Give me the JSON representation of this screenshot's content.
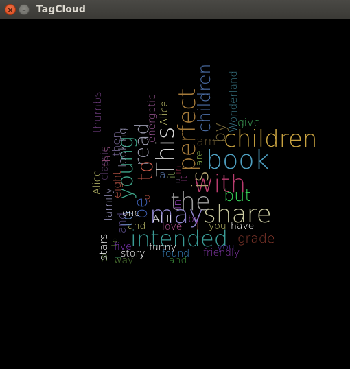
{
  "window": {
    "title": "TagCloud",
    "close_glyph": "×",
    "minimize_glyph": "–"
  },
  "cloud": {
    "words": [
      {
        "text": "share",
        "color": "#c9c9a0"
      },
      {
        "text": "may",
        "color": "#8b82c8"
      },
      {
        "text": "with",
        "color": "#b93c6e"
      },
      {
        "text": "children",
        "color": "#c8a240"
      },
      {
        "text": "book",
        "color": "#4e9fc0"
      },
      {
        "text": "the",
        "color": "#9c9c9c"
      },
      {
        "text": "intended",
        "color": "#3a9c96"
      },
      {
        "text": "is",
        "color": "#b0a070"
      },
      {
        "text": "This",
        "color": "#d8d8d8"
      },
      {
        "text": "perfect",
        "color": "#a57a3a"
      },
      {
        "text": "children",
        "color": "#4c6fa8"
      },
      {
        "text": "young",
        "color": "#3fa58a"
      },
      {
        "text": "read",
        "color": "#9c9cb0"
      },
      {
        "text": "to",
        "color": "#6a8fc8"
      },
      {
        "text": "to",
        "color": "#c85a4a"
      },
      {
        "text": "be",
        "color": "#3a5aa8"
      },
      {
        "text": "but",
        "color": "#39d65a"
      },
      {
        "text": "grade",
        "color": "#8a3a2e"
      },
      {
        "text": "by",
        "color": "#7a6a3a"
      },
      {
        "text": "Wonderland",
        "color": "#3a7a8a"
      },
      {
        "text": "give",
        "color": "#3fa55a"
      },
      {
        "text": "am",
        "color": "#5a4a2a"
      },
      {
        "text": "are",
        "color": "#8ab04a"
      },
      {
        "text": "energetic",
        "color": "#a05a9a"
      },
      {
        "text": "Alice",
        "color": "#c8c870"
      },
      {
        "text": "looking",
        "color": "#a09cc0"
      },
      {
        "text": "then",
        "color": "#7a6a9a"
      },
      {
        "text": "thumbs",
        "color": "#6a3a7a"
      },
      {
        "text": "this",
        "color": "#b05a8a"
      },
      {
        "text": "classic",
        "color": "#5a3a6a"
      },
      {
        "text": "a",
        "color": "#5a7ab0"
      },
      {
        "text": "eight",
        "color": "#c85a4a"
      },
      {
        "text": "family",
        "color": "#a09cc8"
      },
      {
        "text": "and",
        "color": "#6a5aa0"
      },
      {
        "text": "Alice",
        "color": "#c8c870"
      },
      {
        "text": "it",
        "color": "#a0c06a"
      },
      {
        "text": "in",
        "color": "#a02a4a"
      },
      {
        "text": "in",
        "color": "#5a4a6a"
      },
      {
        "text": "it",
        "color": "#9a3a8a"
      },
      {
        "text": "in",
        "color": "#a04ac8"
      },
      {
        "text": "A",
        "color": "#ffffff"
      },
      {
        "text": "to",
        "color": "#c85a4a"
      },
      {
        "text": "one",
        "color": "#ffffff"
      },
      {
        "text": "still",
        "color": "#ffffff"
      },
      {
        "text": "by",
        "color": "#8a3aa8"
      },
      {
        "text": "I",
        "color": "#c86a4a"
      },
      {
        "text": "and",
        "color": "#c8c870"
      },
      {
        "text": "love",
        "color": "#c85aa0"
      },
      {
        "text": "you",
        "color": "#c8c870"
      },
      {
        "text": "have",
        "color": "#ffffff"
      },
      {
        "text": "stars",
        "color": "#ffffff"
      },
      {
        "text": "five",
        "color": "#8a3ac8"
      },
      {
        "text": "funny",
        "color": "#ffffff"
      },
      {
        "text": "you",
        "color": "#5a3ab0"
      },
      {
        "text": "story",
        "color": "#ffffff"
      },
      {
        "text": "found",
        "color": "#3a8ac8"
      },
      {
        "text": "friendly",
        "color": "#8a3ab0"
      },
      {
        "text": "way",
        "color": "#5a8a3a"
      },
      {
        "text": "and",
        "color": "#3a8a3a"
      },
      {
        "text": "to",
        "color": "#5a7a3a"
      },
      {
        "text": "to",
        "color": "#6a8a3a"
      },
      {
        "text": "I",
        "color": "#3a8a5a"
      },
      {
        "text": "I",
        "color": "#5a5a9a"
      }
    ]
  }
}
